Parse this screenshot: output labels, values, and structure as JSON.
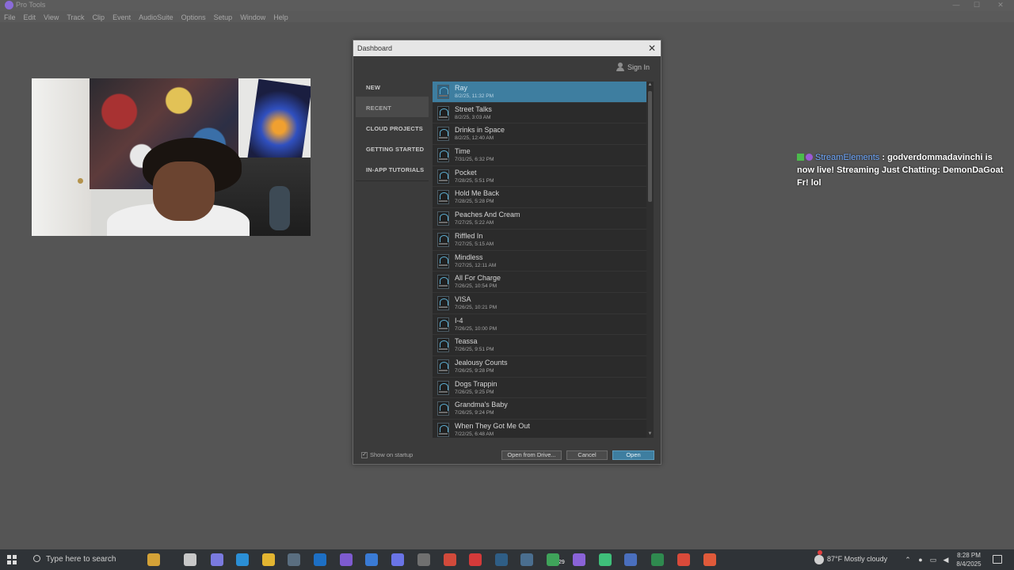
{
  "titlebar": {
    "title": "Pro Tools",
    "min": "—",
    "max": "☐",
    "close": "✕"
  },
  "menubar": [
    "File",
    "Edit",
    "View",
    "Track",
    "Clip",
    "Event",
    "AudioSuite",
    "Options",
    "Setup",
    "Window",
    "Help"
  ],
  "dialog": {
    "title": "Dashboard",
    "close": "✕",
    "sign_in": "Sign In",
    "sidebar": [
      "NEW",
      "RECENT",
      "CLOUD PROJECTS",
      "GETTING STARTED",
      "IN-APP TUTORIALS"
    ],
    "active_sidebar": "RECENT",
    "sessions": [
      {
        "name": "Ray",
        "date": "8/2/25, 11:32 PM"
      },
      {
        "name": "Street Talks",
        "date": "8/2/25, 3:03 AM"
      },
      {
        "name": "Drinks in Space",
        "date": "8/2/25, 12:40 AM"
      },
      {
        "name": "Time",
        "date": "7/31/25, 6:32 PM"
      },
      {
        "name": "Pocket",
        "date": "7/28/25, 5:51 PM"
      },
      {
        "name": "Hold Me Back",
        "date": "7/28/25, 5:28 PM"
      },
      {
        "name": "Peaches And Cream",
        "date": "7/27/25, 5:22 AM"
      },
      {
        "name": "Riffled In",
        "date": "7/27/25, 5:15 AM"
      },
      {
        "name": "Mindless",
        "date": "7/27/25, 12:11 AM"
      },
      {
        "name": "All For Charge",
        "date": "7/26/25, 10:54 PM"
      },
      {
        "name": "VISA",
        "date": "7/26/25, 10:21 PM"
      },
      {
        "name": "I-4",
        "date": "7/26/25, 10:00 PM"
      },
      {
        "name": "Teassa",
        "date": "7/26/25, 9:51 PM"
      },
      {
        "name": "Jealousy Counts",
        "date": "7/26/25, 9:28 PM"
      },
      {
        "name": "Dogs Trappin",
        "date": "7/26/25, 9:25 PM"
      },
      {
        "name": "Grandma's Baby",
        "date": "7/26/25, 9:24 PM"
      },
      {
        "name": "When They Got Me Out",
        "date": "7/22/25, 6:48 AM"
      }
    ],
    "show_on_startup": "Show on startup",
    "show_on_startup_checked": true,
    "buttons": {
      "open_from_drive": "Open from Drive...",
      "cancel": "Cancel",
      "open": "Open"
    }
  },
  "chat": {
    "user": "StreamElements",
    "message_sep": ":",
    "message": "godverdommadavinchi is now live! Streaming Just Chatting: DemonDaGoat Fr! lol"
  },
  "taskbar": {
    "search_placeholder": "Type here to search",
    "badge_count": "29",
    "weather": "87°F  Mostly cloudy",
    "time": "8:28 PM",
    "date": "8/4/2025",
    "icons": [
      {
        "name": "copilot-icon",
        "color": "#d4a237"
      },
      {
        "name": "task-view-icon",
        "color": "#c8c8c8"
      },
      {
        "name": "copilot-app-icon",
        "color": "#7a7adf"
      },
      {
        "name": "edge-icon",
        "color": "#2b8fd6"
      },
      {
        "name": "file-explorer-icon",
        "color": "#e3b531"
      },
      {
        "name": "photos-icon",
        "color": "#5a6e80"
      },
      {
        "name": "outlook-icon",
        "color": "#1d6fc4"
      },
      {
        "name": "pro-tools-icon",
        "color": "#7e5bd0"
      },
      {
        "name": "store-icon",
        "color": "#3a7bd5"
      },
      {
        "name": "discord-icon",
        "color": "#6a74e6"
      },
      {
        "name": "media-player-icon",
        "color": "#707070"
      },
      {
        "name": "chrome-icon",
        "color": "#d24a3b"
      },
      {
        "name": "capcut-icon",
        "color": "#d43a3a"
      },
      {
        "name": "steam-icon",
        "color": "#2f5e86"
      },
      {
        "name": "app-icon",
        "color": "#4a6e8f"
      },
      {
        "name": "whatsapp-icon",
        "color": "#3fa35a"
      },
      {
        "name": "pro-tools-2-icon",
        "color": "#8a63d8"
      },
      {
        "name": "robinhood-icon",
        "color": "#3fbf7a"
      },
      {
        "name": "app-2-icon",
        "color": "#4a6fbd"
      },
      {
        "name": "excel-icon",
        "color": "#2f8a4f"
      },
      {
        "name": "chrome-2-icon",
        "color": "#d94a3a"
      },
      {
        "name": "chrome-3-icon",
        "color": "#e05a3a"
      }
    ]
  }
}
